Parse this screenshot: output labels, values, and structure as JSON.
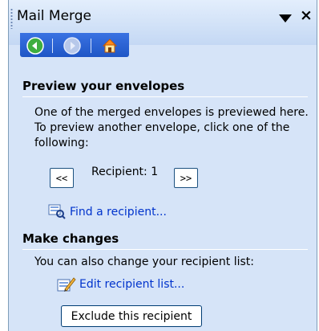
{
  "pane": {
    "title": "Mail Merge"
  },
  "nav_icons": [
    "back-icon",
    "forward-icon",
    "home-icon"
  ],
  "preview": {
    "heading": "Preview your envelopes",
    "description": "One of the merged envelopes is previewed here. To preview another envelope, click one of the following:",
    "prev_label": "<<",
    "next_label": ">>",
    "recipient_text": "Recipient: 1",
    "find_link": "Find a recipient..."
  },
  "changes": {
    "heading": "Make changes",
    "description": "You can also change your recipient list:",
    "edit_link": "Edit recipient list...",
    "exclude_button": "Exclude this recipient"
  },
  "colors": {
    "pane_bg": "#d6e4f8",
    "nav_bar": "#2a63d6",
    "link": "#0033cc"
  }
}
